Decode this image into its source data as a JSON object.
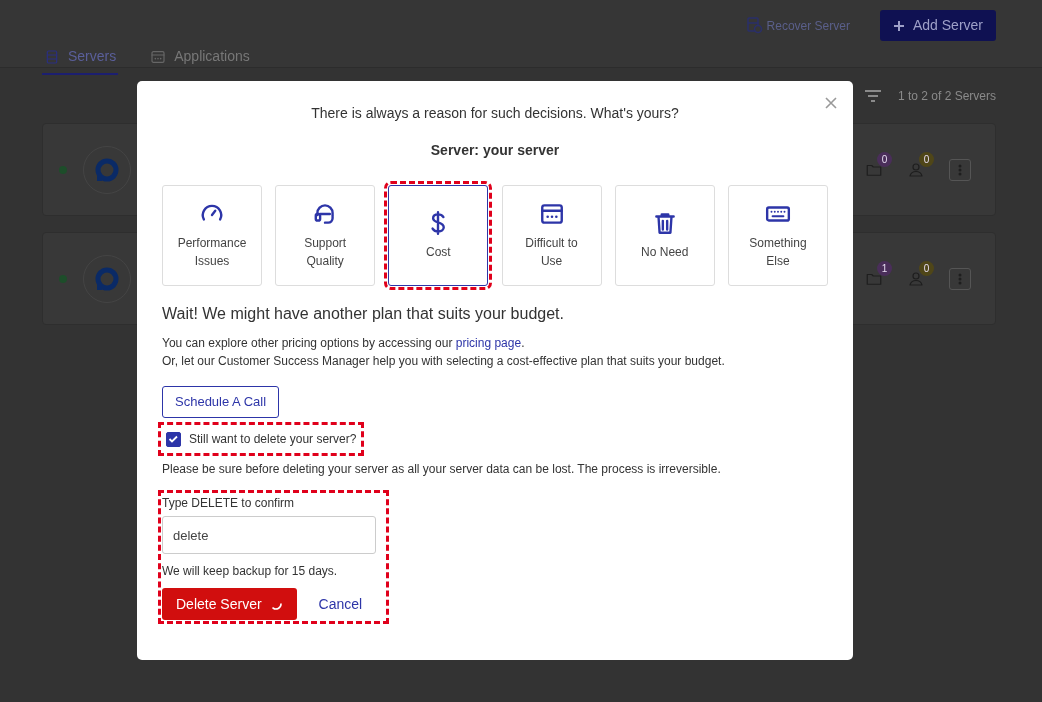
{
  "header": {
    "recover_label": "Recover Server",
    "add_label": "Add Server"
  },
  "tabs": [
    {
      "label": "Servers",
      "selected": true
    },
    {
      "label": "Applications",
      "selected": false
    }
  ],
  "pagination": "1 to 2 of 2 Servers",
  "servers": [
    {
      "badges": [
        "0",
        "0"
      ]
    },
    {
      "badges": [
        "1",
        "0"
      ]
    }
  ],
  "modal": {
    "title": "There is always a reason for such decisions. What's yours?",
    "server_label": "Server: your server",
    "reasons": [
      {
        "label": "Performance Issues",
        "selected": false,
        "highlighted": false
      },
      {
        "label": "Support Quality",
        "selected": false,
        "highlighted": false
      },
      {
        "label": "Cost",
        "selected": true,
        "highlighted": true
      },
      {
        "label": "Difficult to Use",
        "selected": false,
        "highlighted": false
      },
      {
        "label": "No Need",
        "selected": false,
        "highlighted": false
      },
      {
        "label": "Something Else",
        "selected": false,
        "highlighted": false
      }
    ],
    "heading": "Wait! We might have another plan that suits your budget.",
    "explore": {
      "before": "You can explore other pricing options by accessing our ",
      "link": "pricing page",
      "after": "."
    },
    "manager_text": "Or, let our Customer Success Manager help you with selecting a cost-effective plan that suits your budget.",
    "schedule_button": "Schedule A Call",
    "confirm_checkbox": {
      "label": "Still want to delete your server?",
      "checked": true,
      "highlighted": true
    },
    "warning": "Please be sure before deleting your server as all your server data can be lost. The process is irreversible.",
    "confirm_section": {
      "highlighted": true,
      "label": "Type DELETE to confirm",
      "value": "delete",
      "note": "We will keep backup for 15 days.",
      "delete_button": {
        "label": "Delete Server",
        "loading": true
      },
      "cancel": "Cancel"
    }
  }
}
